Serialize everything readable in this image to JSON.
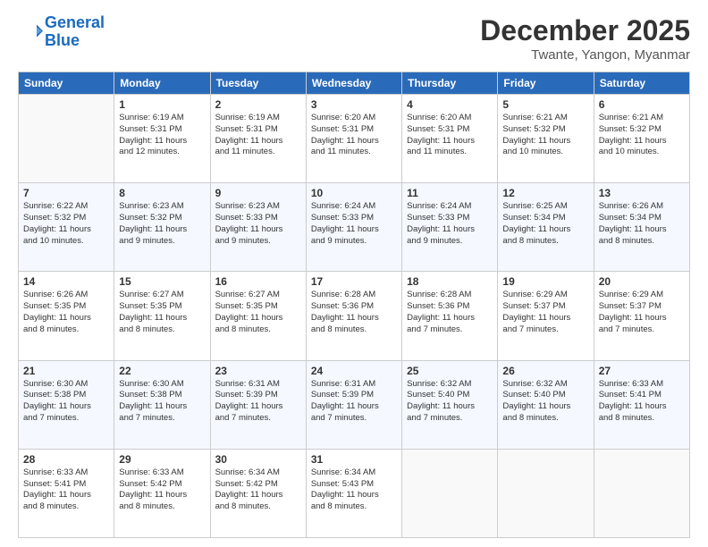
{
  "header": {
    "logo_line1": "General",
    "logo_line2": "Blue",
    "title": "December 2025",
    "subtitle": "Twante, Yangon, Myanmar"
  },
  "days_of_week": [
    "Sunday",
    "Monday",
    "Tuesday",
    "Wednesday",
    "Thursday",
    "Friday",
    "Saturday"
  ],
  "weeks": [
    [
      {
        "day": "",
        "info": ""
      },
      {
        "day": "1",
        "info": "Sunrise: 6:19 AM\nSunset: 5:31 PM\nDaylight: 11 hours\nand 12 minutes."
      },
      {
        "day": "2",
        "info": "Sunrise: 6:19 AM\nSunset: 5:31 PM\nDaylight: 11 hours\nand 11 minutes."
      },
      {
        "day": "3",
        "info": "Sunrise: 6:20 AM\nSunset: 5:31 PM\nDaylight: 11 hours\nand 11 minutes."
      },
      {
        "day": "4",
        "info": "Sunrise: 6:20 AM\nSunset: 5:31 PM\nDaylight: 11 hours\nand 11 minutes."
      },
      {
        "day": "5",
        "info": "Sunrise: 6:21 AM\nSunset: 5:32 PM\nDaylight: 11 hours\nand 10 minutes."
      },
      {
        "day": "6",
        "info": "Sunrise: 6:21 AM\nSunset: 5:32 PM\nDaylight: 11 hours\nand 10 minutes."
      }
    ],
    [
      {
        "day": "7",
        "info": "Sunrise: 6:22 AM\nSunset: 5:32 PM\nDaylight: 11 hours\nand 10 minutes."
      },
      {
        "day": "8",
        "info": "Sunrise: 6:23 AM\nSunset: 5:32 PM\nDaylight: 11 hours\nand 9 minutes."
      },
      {
        "day": "9",
        "info": "Sunrise: 6:23 AM\nSunset: 5:33 PM\nDaylight: 11 hours\nand 9 minutes."
      },
      {
        "day": "10",
        "info": "Sunrise: 6:24 AM\nSunset: 5:33 PM\nDaylight: 11 hours\nand 9 minutes."
      },
      {
        "day": "11",
        "info": "Sunrise: 6:24 AM\nSunset: 5:33 PM\nDaylight: 11 hours\nand 9 minutes."
      },
      {
        "day": "12",
        "info": "Sunrise: 6:25 AM\nSunset: 5:34 PM\nDaylight: 11 hours\nand 8 minutes."
      },
      {
        "day": "13",
        "info": "Sunrise: 6:26 AM\nSunset: 5:34 PM\nDaylight: 11 hours\nand 8 minutes."
      }
    ],
    [
      {
        "day": "14",
        "info": "Sunrise: 6:26 AM\nSunset: 5:35 PM\nDaylight: 11 hours\nand 8 minutes."
      },
      {
        "day": "15",
        "info": "Sunrise: 6:27 AM\nSunset: 5:35 PM\nDaylight: 11 hours\nand 8 minutes."
      },
      {
        "day": "16",
        "info": "Sunrise: 6:27 AM\nSunset: 5:35 PM\nDaylight: 11 hours\nand 8 minutes."
      },
      {
        "day": "17",
        "info": "Sunrise: 6:28 AM\nSunset: 5:36 PM\nDaylight: 11 hours\nand 8 minutes."
      },
      {
        "day": "18",
        "info": "Sunrise: 6:28 AM\nSunset: 5:36 PM\nDaylight: 11 hours\nand 7 minutes."
      },
      {
        "day": "19",
        "info": "Sunrise: 6:29 AM\nSunset: 5:37 PM\nDaylight: 11 hours\nand 7 minutes."
      },
      {
        "day": "20",
        "info": "Sunrise: 6:29 AM\nSunset: 5:37 PM\nDaylight: 11 hours\nand 7 minutes."
      }
    ],
    [
      {
        "day": "21",
        "info": "Sunrise: 6:30 AM\nSunset: 5:38 PM\nDaylight: 11 hours\nand 7 minutes."
      },
      {
        "day": "22",
        "info": "Sunrise: 6:30 AM\nSunset: 5:38 PM\nDaylight: 11 hours\nand 7 minutes."
      },
      {
        "day": "23",
        "info": "Sunrise: 6:31 AM\nSunset: 5:39 PM\nDaylight: 11 hours\nand 7 minutes."
      },
      {
        "day": "24",
        "info": "Sunrise: 6:31 AM\nSunset: 5:39 PM\nDaylight: 11 hours\nand 7 minutes."
      },
      {
        "day": "25",
        "info": "Sunrise: 6:32 AM\nSunset: 5:40 PM\nDaylight: 11 hours\nand 7 minutes."
      },
      {
        "day": "26",
        "info": "Sunrise: 6:32 AM\nSunset: 5:40 PM\nDaylight: 11 hours\nand 8 minutes."
      },
      {
        "day": "27",
        "info": "Sunrise: 6:33 AM\nSunset: 5:41 PM\nDaylight: 11 hours\nand 8 minutes."
      }
    ],
    [
      {
        "day": "28",
        "info": "Sunrise: 6:33 AM\nSunset: 5:41 PM\nDaylight: 11 hours\nand 8 minutes."
      },
      {
        "day": "29",
        "info": "Sunrise: 6:33 AM\nSunset: 5:42 PM\nDaylight: 11 hours\nand 8 minutes."
      },
      {
        "day": "30",
        "info": "Sunrise: 6:34 AM\nSunset: 5:42 PM\nDaylight: 11 hours\nand 8 minutes."
      },
      {
        "day": "31",
        "info": "Sunrise: 6:34 AM\nSunset: 5:43 PM\nDaylight: 11 hours\nand 8 minutes."
      },
      {
        "day": "",
        "info": ""
      },
      {
        "day": "",
        "info": ""
      },
      {
        "day": "",
        "info": ""
      }
    ]
  ]
}
